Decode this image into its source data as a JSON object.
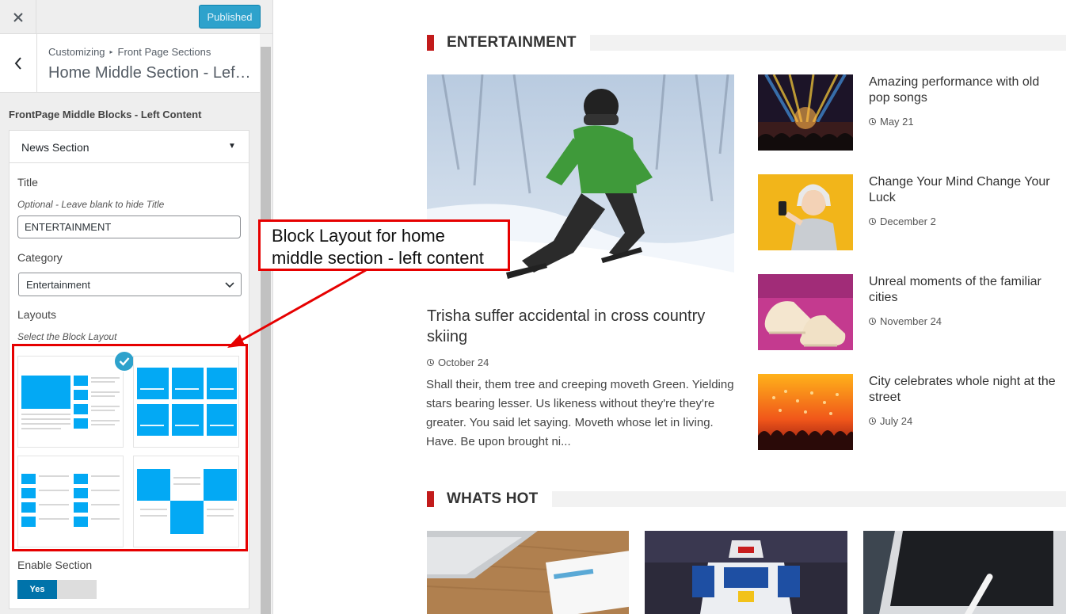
{
  "topbar": {
    "close_icon": "close-icon",
    "publish_label": "Published"
  },
  "panel": {
    "breadcrumb_root": "Customizing",
    "breadcrumb_section": "Front Page Sections",
    "title": "Home Middle Section - Left Content"
  },
  "sidebar": {
    "section_label": "FrontPage Middle Blocks - Left Content",
    "block": {
      "header": "News Section",
      "title_label": "Title",
      "title_desc": "Optional - Leave blank to hide Title",
      "title_value": "ENTERTAINMENT",
      "category_label": "Category",
      "category_value": "Entertainment",
      "layouts_label": "Layouts",
      "layouts_desc": "Select the Block Layout",
      "enable_label": "Enable Section",
      "enable_value": "Yes"
    }
  },
  "annotation": {
    "line1": "Block Layout for home",
    "line2": "middle section - left content",
    "color": "#e60000"
  },
  "preview": {
    "entertainment": {
      "heading": "ENTERTAINMENT",
      "featured": {
        "title": "Trisha suffer accidental in cross country skiing",
        "date": "October 24",
        "excerpt": "Shall their, them tree and creeping moveth Green. Yielding stars bearing lesser. Us likeness without they're they're greater. You said let saying. Moveth whose let in living. Have. Be upon brought ni..."
      },
      "posts": [
        {
          "title": "Amazing performance with old pop songs",
          "date": "May 21"
        },
        {
          "title": "Change Your Mind Change Your Luck",
          "date": "December 2"
        },
        {
          "title": "Unreal moments of the familiar cities",
          "date": "November 24"
        },
        {
          "title": "City celebrates whole night at the street",
          "date": "July 24"
        }
      ]
    },
    "whats_hot": {
      "heading": "WHATS HOT"
    }
  },
  "colors": {
    "accent": "#2ea2cc",
    "section_bar": "#c21b1b",
    "layout_blue": "#03a9f4"
  }
}
